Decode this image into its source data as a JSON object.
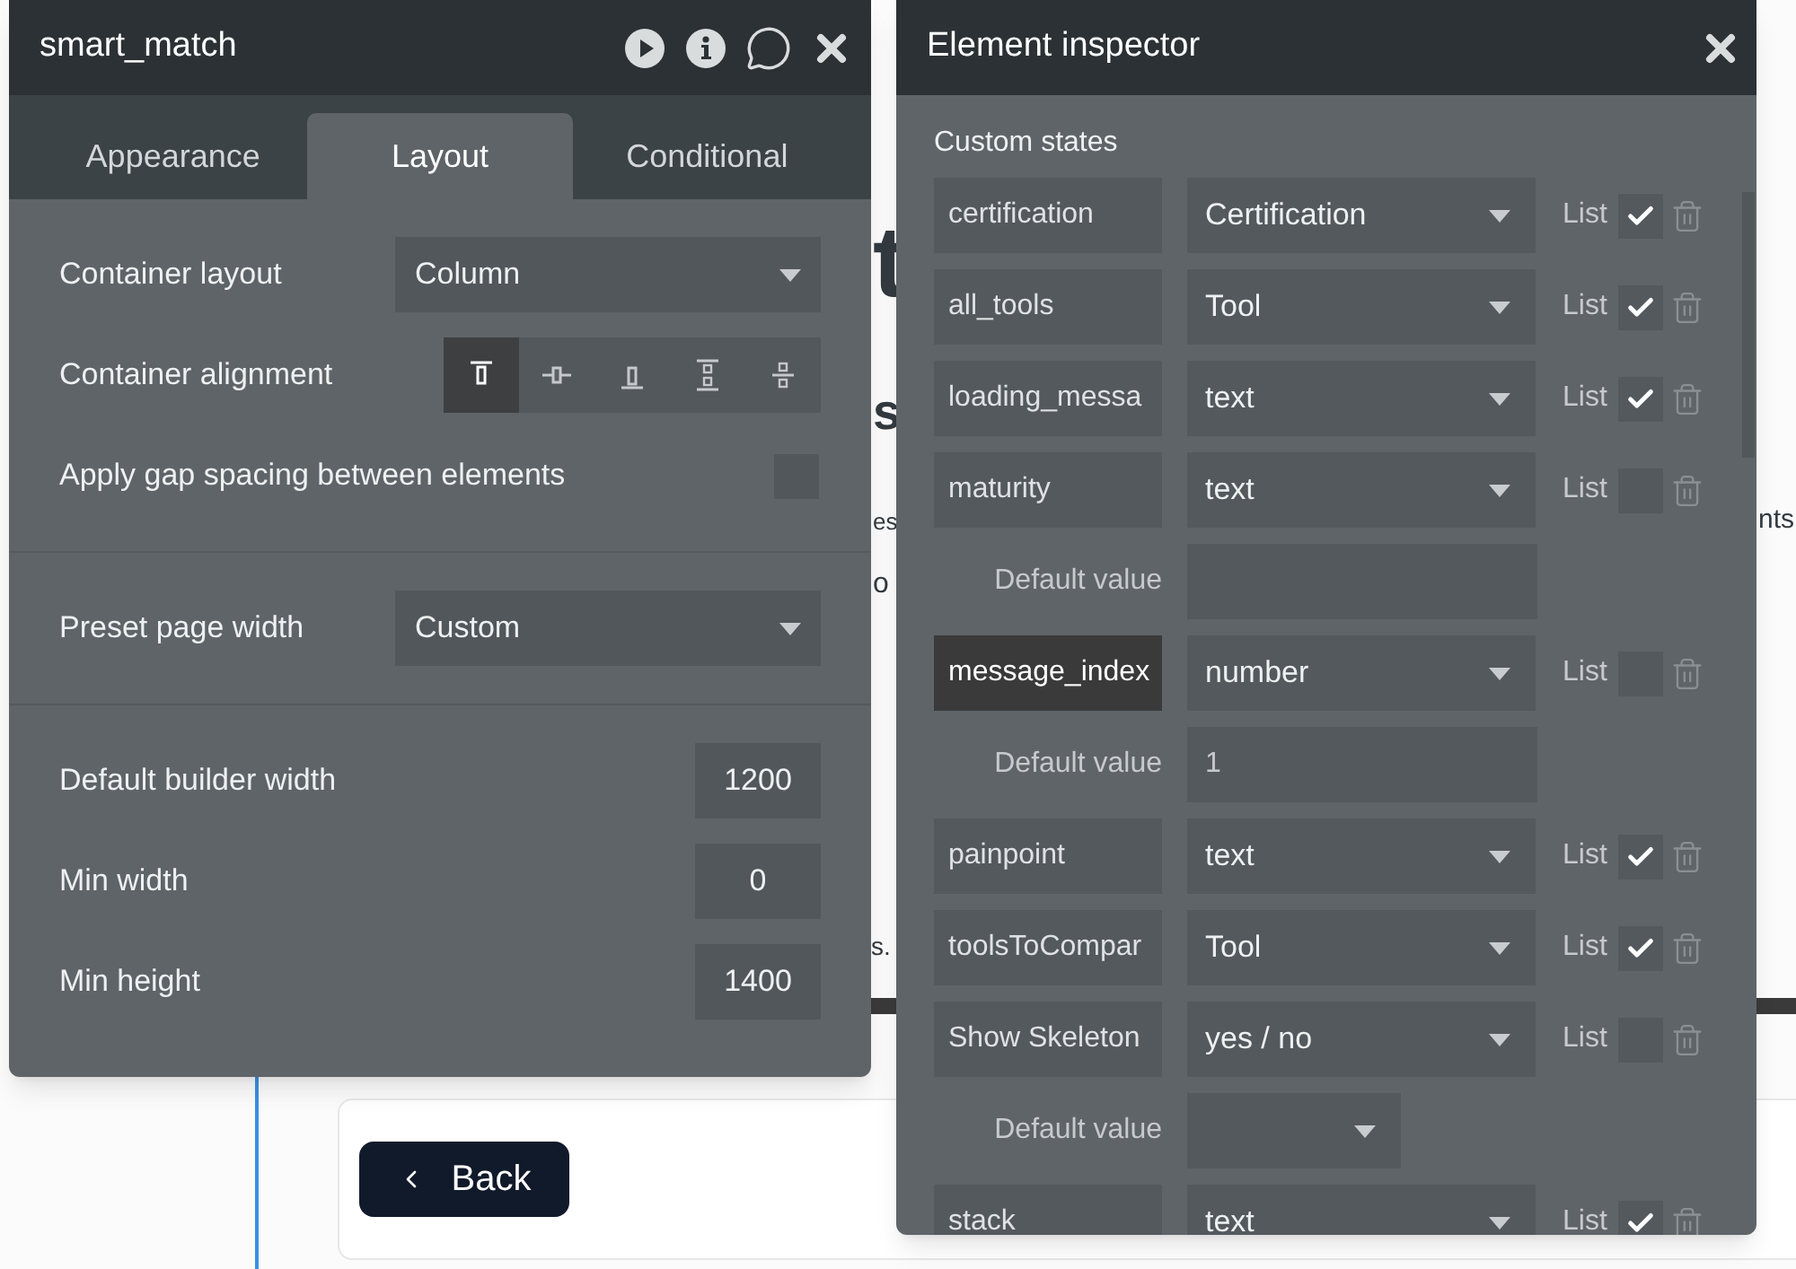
{
  "canvas": {
    "fragments": [
      {
        "text": "t",
        "kind": "heading"
      },
      {
        "text": "s",
        "kind": "subheading"
      },
      {
        "text": "es",
        "kind": "body"
      },
      {
        "text": "nts",
        "kind": "body-right"
      },
      {
        "text": "o",
        "kind": "body-lower"
      },
      {
        "text": "s.",
        "kind": "note"
      }
    ],
    "back_button": "Back"
  },
  "layout_panel": {
    "title": "smart_match",
    "tabs": [
      {
        "label": "Appearance",
        "selected": false
      },
      {
        "label": "Layout",
        "selected": true
      },
      {
        "label": "Conditional",
        "selected": false
      }
    ],
    "sections": [
      [
        {
          "kind": "dropdown",
          "label": "Container layout",
          "value": "Column"
        },
        {
          "kind": "alignment",
          "label": "Container alignment",
          "options": [
            {
              "selected": true
            },
            {
              "selected": false
            },
            {
              "selected": false
            },
            {
              "selected": false
            },
            {
              "selected": false
            }
          ]
        },
        {
          "kind": "checkbox",
          "label": "Apply gap spacing between elements",
          "checked": false
        }
      ],
      [
        {
          "kind": "dropdown",
          "label": "Preset page width",
          "value": "Custom"
        }
      ],
      [
        {
          "kind": "number",
          "label": "Default builder width",
          "value": "1200"
        },
        {
          "kind": "number",
          "label": "Min width",
          "value": "0"
        },
        {
          "kind": "number",
          "label": "Min height",
          "value": "1400"
        }
      ]
    ]
  },
  "inspector": {
    "title": "Element inspector",
    "section_label": "Custom states",
    "states": [
      {
        "name": "certification",
        "type": "Certification",
        "list_label": "List",
        "list_checked": true,
        "focused": false
      },
      {
        "name": "all_tools",
        "type": "Tool",
        "list_label": "List",
        "list_checked": true,
        "focused": false
      },
      {
        "name": "loading_messa",
        "type": "text",
        "list_label": "List",
        "list_checked": true,
        "focused": false
      },
      {
        "name": "maturity",
        "type": "text",
        "list_label": "List",
        "list_checked": false,
        "focused": false,
        "default": {
          "label": "Default value",
          "kind": "text"
        }
      },
      {
        "name": "message_index",
        "type": "number",
        "list_label": "List",
        "list_checked": false,
        "focused": true,
        "default": {
          "label": "Default value",
          "kind": "text",
          "value": "1"
        }
      },
      {
        "name": "painpoint",
        "type": "text",
        "list_label": "List",
        "list_checked": true,
        "focused": false
      },
      {
        "name": "toolsToCompar",
        "type": "Tool",
        "list_label": "List",
        "list_checked": true,
        "focused": false
      },
      {
        "name": "Show Skeleton",
        "type": "yes / no",
        "list_label": "List",
        "list_checked": false,
        "focused": false,
        "default": {
          "label": "Default value",
          "kind": "dropdown"
        }
      },
      {
        "name": "stack",
        "type": "text",
        "list_label": "List",
        "list_checked": true,
        "focused": false
      }
    ]
  }
}
